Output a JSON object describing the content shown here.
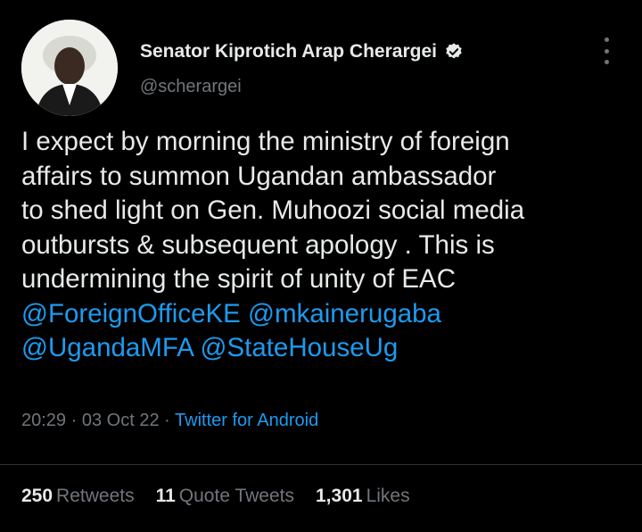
{
  "author": {
    "name": "Senator Kiprotich Arap Cherargei",
    "handle": "@scherargei",
    "verified_icon": "verified-badge-icon"
  },
  "tweet": {
    "lines": [
      "I expect by morning the ministry of foreign",
      "affairs to summon Ugandan ambassador",
      "to shed light on Gen. Muhoozi social media",
      "outbursts & subsequent apology . This is",
      "undermining the spirit of unity of EAC"
    ],
    "mentions": [
      "@ForeignOfficeKE",
      "@mkainerugaba",
      "@UgandaMFA",
      "@StateHouseUg"
    ]
  },
  "meta": {
    "time": "20:29",
    "date": "03 Oct 22",
    "source": "Twitter for Android",
    "separator": "·"
  },
  "stats": {
    "retweets_count": "250",
    "retweets_label": "Retweets",
    "quotes_count": "11",
    "quotes_label": "Quote Tweets",
    "likes_count": "1,301",
    "likes_label": "Likes"
  },
  "colors": {
    "background": "#000000",
    "text": "#e7e9ea",
    "muted": "#71767b",
    "link": "#1d9bf0"
  }
}
